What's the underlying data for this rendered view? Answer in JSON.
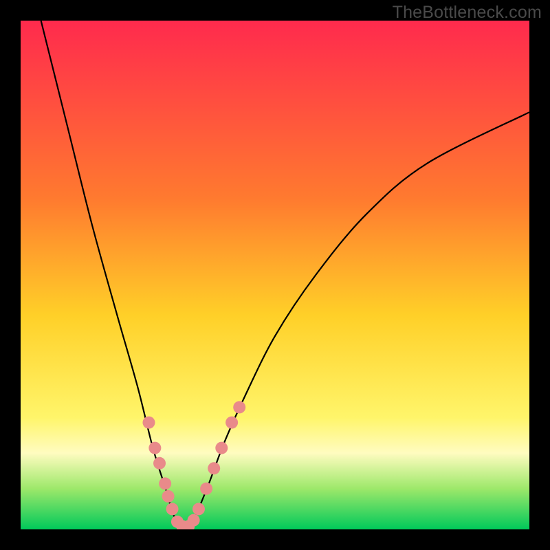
{
  "watermark": "TheBottleneck.com",
  "chart_data": {
    "type": "line",
    "title": "",
    "xlabel": "",
    "ylabel": "",
    "xlim": [
      0,
      100
    ],
    "ylim": [
      0,
      100
    ],
    "grid": false,
    "gradient_stops": [
      {
        "offset": 0,
        "color": "#ff2a4d"
      },
      {
        "offset": 35,
        "color": "#ff7a2f"
      },
      {
        "offset": 58,
        "color": "#ffd028"
      },
      {
        "offset": 78,
        "color": "#fff56a"
      },
      {
        "offset": 85,
        "color": "#fffcc0"
      },
      {
        "offset": 92,
        "color": "#9de86a"
      },
      {
        "offset": 100,
        "color": "#00c95a"
      }
    ],
    "series": [
      {
        "name": "bottleneck-curve",
        "color": "#000000",
        "points": [
          {
            "x": 4,
            "y": 100
          },
          {
            "x": 9,
            "y": 80
          },
          {
            "x": 14,
            "y": 60
          },
          {
            "x": 19,
            "y": 42
          },
          {
            "x": 23,
            "y": 28
          },
          {
            "x": 26,
            "y": 16
          },
          {
            "x": 28.5,
            "y": 8
          },
          {
            "x": 30,
            "y": 3
          },
          {
            "x": 31.5,
            "y": 0.5
          },
          {
            "x": 33,
            "y": 0.5
          },
          {
            "x": 34.5,
            "y": 3
          },
          {
            "x": 37,
            "y": 9
          },
          {
            "x": 40,
            "y": 17
          },
          {
            "x": 44,
            "y": 26
          },
          {
            "x": 50,
            "y": 38
          },
          {
            "x": 58,
            "y": 50
          },
          {
            "x": 68,
            "y": 62
          },
          {
            "x": 80,
            "y": 72
          },
          {
            "x": 100,
            "y": 82
          }
        ]
      },
      {
        "name": "highlight-dots",
        "color": "#e98a8a",
        "points": [
          {
            "x": 25.2,
            "y": 21
          },
          {
            "x": 26.4,
            "y": 16
          },
          {
            "x": 27.3,
            "y": 13
          },
          {
            "x": 28.4,
            "y": 9
          },
          {
            "x": 29.0,
            "y": 6.5
          },
          {
            "x": 29.8,
            "y": 4
          },
          {
            "x": 30.8,
            "y": 1.5
          },
          {
            "x": 31.8,
            "y": 0.6
          },
          {
            "x": 33.0,
            "y": 0.6
          },
          {
            "x": 34.0,
            "y": 1.8
          },
          {
            "x": 35.0,
            "y": 4
          },
          {
            "x": 36.5,
            "y": 8
          },
          {
            "x": 38.0,
            "y": 12
          },
          {
            "x": 39.5,
            "y": 16
          },
          {
            "x": 41.5,
            "y": 21
          },
          {
            "x": 43.0,
            "y": 24
          }
        ]
      }
    ]
  }
}
